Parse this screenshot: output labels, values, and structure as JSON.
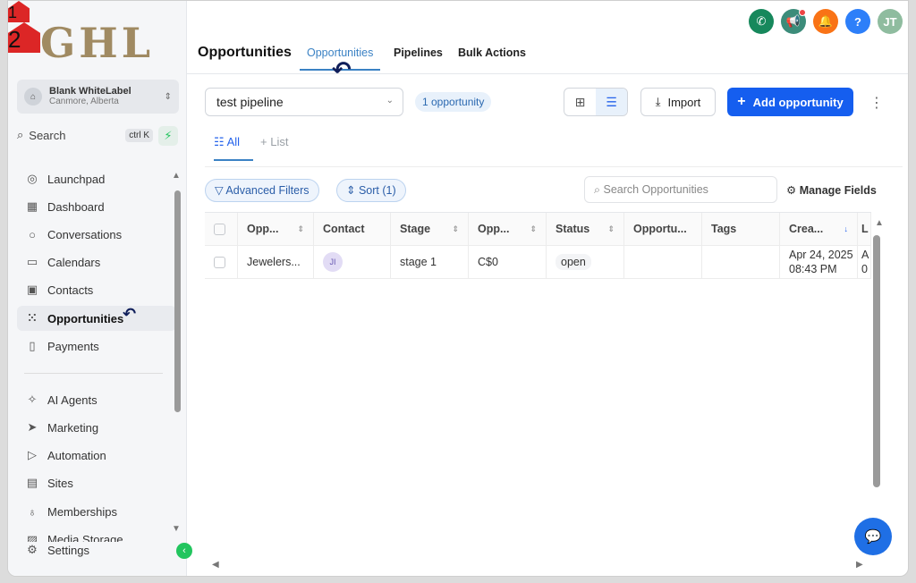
{
  "logo": "GHL",
  "account": {
    "name": "Blank WhiteLabel",
    "location": "Canmore, Alberta"
  },
  "search": {
    "label": "Search",
    "shortcut": "ctrl K"
  },
  "sidebar": {
    "items": [
      {
        "label": "Launchpad",
        "icon": "rocket-icon"
      },
      {
        "label": "Dashboard",
        "icon": "grid-icon"
      },
      {
        "label": "Conversations",
        "icon": "chat-icon"
      },
      {
        "label": "Calendars",
        "icon": "calendar-icon"
      },
      {
        "label": "Contacts",
        "icon": "contacts-icon"
      },
      {
        "label": "Opportunities",
        "icon": "funnel-icon",
        "active": true
      },
      {
        "label": "Payments",
        "icon": "payment-icon"
      },
      {
        "label": "AI Agents",
        "icon": "sparkle-icon"
      },
      {
        "label": "Marketing",
        "icon": "send-icon"
      },
      {
        "label": "Automation",
        "icon": "automation-icon"
      },
      {
        "label": "Sites",
        "icon": "sites-icon"
      },
      {
        "label": "Memberships",
        "icon": "award-icon"
      },
      {
        "label": "Media Storage",
        "icon": "image-icon"
      },
      {
        "label": "Settings",
        "icon": "gear-icon"
      }
    ]
  },
  "annotations": {
    "first": "1",
    "second": "2"
  },
  "header": {
    "title": "Opportunities",
    "tabs": [
      {
        "label": "Opportunities",
        "active": true
      },
      {
        "label": "Pipelines"
      },
      {
        "label": "Bulk Actions"
      }
    ],
    "avatar_initials": "JT",
    "icons": [
      "phone-icon",
      "megaphone-icon",
      "bell-icon",
      "help-icon"
    ],
    "help_glyph": "?"
  },
  "toolbar": {
    "pipeline": "test pipeline",
    "count": "1 opportunity",
    "import_label": "Import",
    "add_label": "Add opportunity"
  },
  "list_tabs": {
    "all": "All",
    "list": "List"
  },
  "filters": {
    "advanced": "Advanced Filters",
    "sort": "Sort (1)",
    "search_placeholder": "Search Opportunities",
    "manage_fields": "Manage Fields"
  },
  "table": {
    "columns": [
      "Opp...",
      "Contact",
      "Stage",
      "Opp...",
      "Status",
      "Opportu...",
      "Tags",
      "Crea...",
      "L"
    ],
    "rows": [
      {
        "name": "Jewelers...",
        "contact_initials": "JI",
        "stage": "stage 1",
        "value": "C$0",
        "status": "open",
        "opportunity": "",
        "tags": "",
        "created_date": "Apr 24, 2025",
        "created_time": "08:43 PM",
        "extra_1": "A",
        "extra_2": "0"
      }
    ]
  },
  "colors": {
    "accent": "#155eef",
    "active_tab": "#3b82c4",
    "annotation": "#dc2626"
  }
}
